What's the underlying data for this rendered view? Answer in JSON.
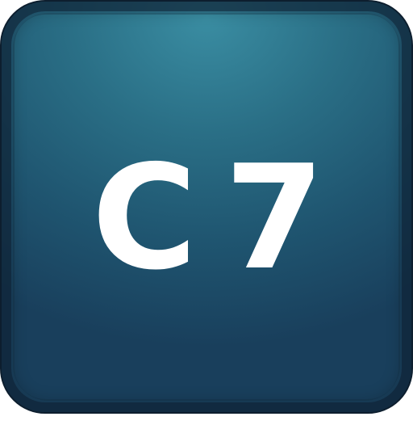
{
  "app_icon": {
    "label_parts": [
      "C",
      "7"
    ],
    "colors": {
      "background_top": "#3a8da2",
      "background_bottom": "#193f5c",
      "border": "#0d1e2e",
      "text": "#ffffff"
    }
  }
}
